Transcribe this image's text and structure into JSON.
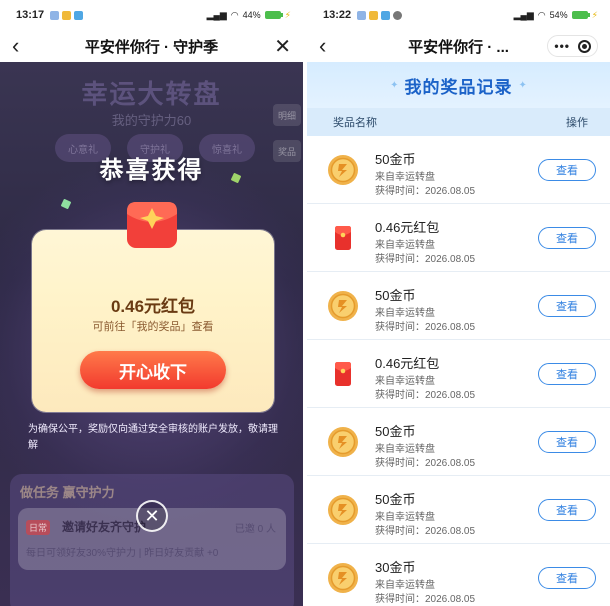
{
  "left_screen": {
    "status_bar": {
      "time": "13:17",
      "right_text": "44%"
    },
    "nav": {
      "title": "平安伴你行 · 守护季"
    },
    "background": {
      "wheel_title": "幸运大转盘",
      "guard_power": "我的守护力60",
      "side_tabs": [
        "明细",
        "奖品"
      ],
      "gift_tabs": [
        "心意礼",
        "守护礼",
        "惊喜礼"
      ]
    },
    "modal": {
      "heading": "恭喜获得",
      "prize_amount": "0.46元红包",
      "prize_hint": "可前往「我的奖品」查看",
      "accept_button": "开心收下",
      "notice": "为确保公平，奖励仅向通过安全审核的账户发放，敬请理解"
    },
    "tasks": {
      "title": "做任务 赢守护力",
      "tag": "日常",
      "name": "邀请好友齐守护",
      "progress": "已邀 0 人",
      "desc": "每日可领好友30%守护力 | 昨日好友贡献 +0"
    }
  },
  "right_screen": {
    "status_bar": {
      "time": "13:22",
      "right_text": "54%"
    },
    "nav": {
      "title": "平安伴你行 · ..."
    },
    "records": {
      "title": "我的奖品记录",
      "col_name": "奖品名称",
      "col_action": "操作",
      "view_label": "查看",
      "items": [
        {
          "icon": "coin-icon",
          "name": "50金币",
          "source": "来自幸运转盘",
          "time": "获得时间：2026.08.05"
        },
        {
          "icon": "red-packet-icon",
          "name": "0.46元红包",
          "source": "来自幸运转盘",
          "time": "获得时间：2026.08.05"
        },
        {
          "icon": "coin-icon",
          "name": "50金币",
          "source": "来自幸运转盘",
          "time": "获得时间：2026.08.05"
        },
        {
          "icon": "red-packet-icon",
          "name": "0.46元红包",
          "source": "来自幸运转盘",
          "time": "获得时间：2026.08.05"
        },
        {
          "icon": "coin-icon",
          "name": "50金币",
          "source": "来自幸运转盘",
          "time": "获得时间：2026.08.05"
        },
        {
          "icon": "coin-icon",
          "name": "50金币",
          "source": "来自幸运转盘",
          "time": "获得时间：2026.08.05"
        },
        {
          "icon": "coin-icon",
          "name": "30金币",
          "source": "来自幸运转盘",
          "time": "获得时间：2026.08.05"
        }
      ]
    }
  },
  "colors": {
    "accent_blue": "#1b62c8",
    "button_red": "#f23a2e",
    "modal_bg": "#fff3c9"
  }
}
